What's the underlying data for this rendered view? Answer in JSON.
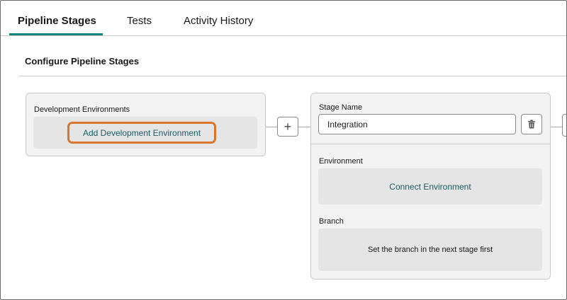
{
  "tabs": [
    {
      "label": "Pipeline Stages",
      "active": true
    },
    {
      "label": "Tests",
      "active": false
    },
    {
      "label": "Activity History",
      "active": false
    }
  ],
  "section": {
    "title": "Configure Pipeline Stages"
  },
  "dev_card": {
    "label": "Development Environments",
    "add_button": "Add Development Environment"
  },
  "add_stage_button": {
    "label": "+"
  },
  "stage_card": {
    "name_label": "Stage Name",
    "name_value": "Integration",
    "environment_label": "Environment",
    "connect_button": "Connect Environment",
    "branch_label": "Branch",
    "branch_message": "Set the branch in the next stage first"
  },
  "icons": {
    "delete": "trash-icon"
  },
  "colors": {
    "accent_tab_underline": "#0b827c",
    "link_text": "#1b5c66",
    "highlight_outline": "#d9772e"
  }
}
